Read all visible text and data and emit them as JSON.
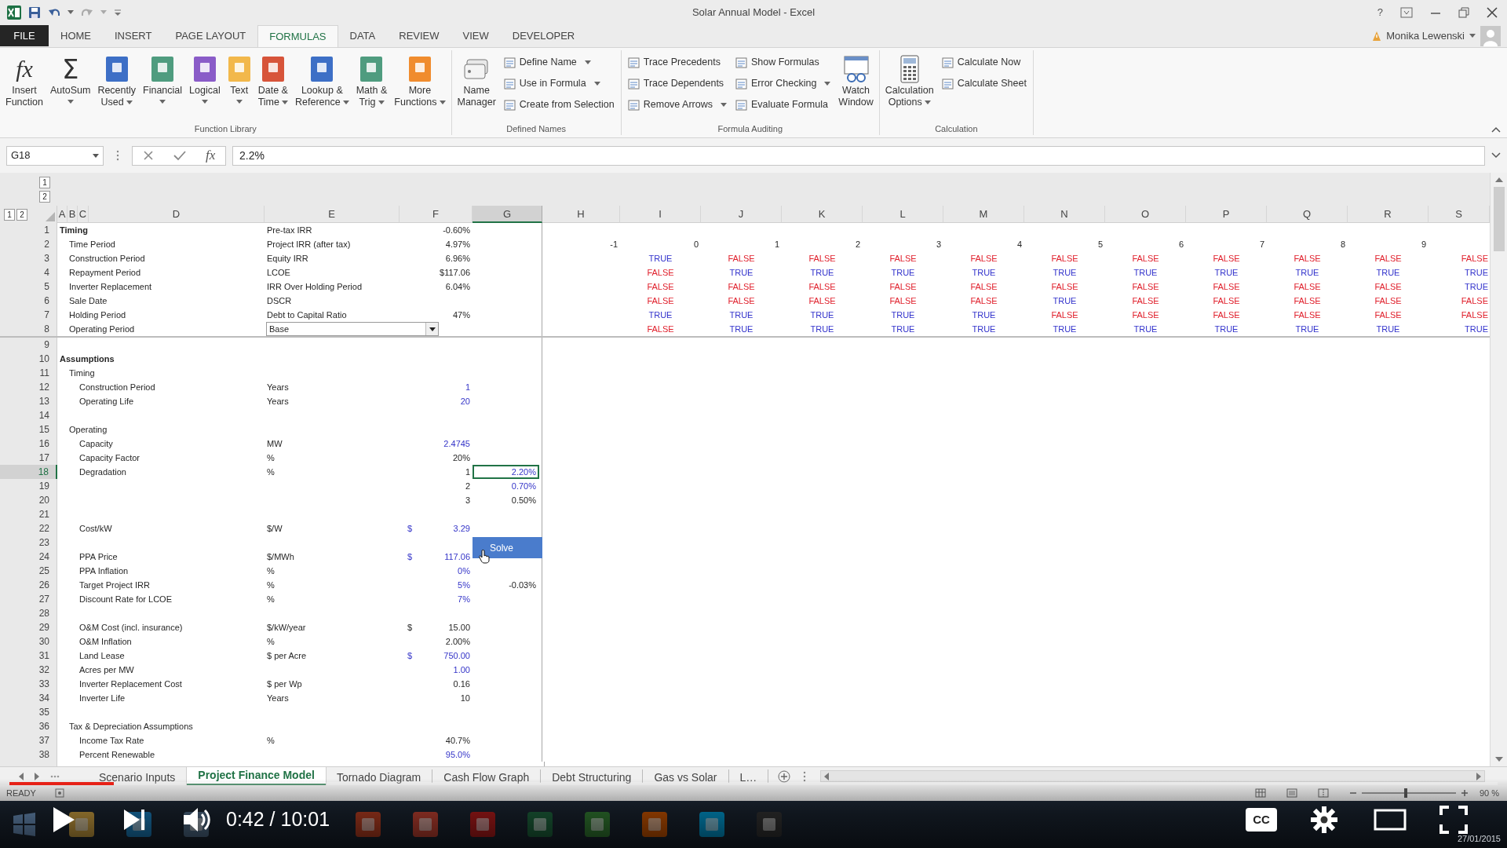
{
  "window": {
    "title": "Solar Annual Model - Excel",
    "help": "?",
    "user": "Monika Lewenski"
  },
  "tabs": [
    {
      "label": "FILE",
      "kind": "backstage",
      "selected": false
    },
    {
      "label": "HOME",
      "kind": "tab",
      "selected": false
    },
    {
      "label": "INSERT",
      "kind": "tab",
      "selected": false
    },
    {
      "label": "PAGE LAYOUT",
      "kind": "tab",
      "selected": false
    },
    {
      "label": "FORMULAS",
      "kind": "tab",
      "selected": true
    },
    {
      "label": "DATA",
      "kind": "tab",
      "selected": false
    },
    {
      "label": "REVIEW",
      "kind": "tab",
      "selected": false
    },
    {
      "label": "VIEW",
      "kind": "tab",
      "selected": false
    },
    {
      "label": "DEVELOPER",
      "kind": "tab",
      "selected": false
    }
  ],
  "ribbon": {
    "groups": [
      {
        "label": "Function Library",
        "items": [
          {
            "kind": "fx",
            "glyph": "fx",
            "label": "Insert\nFunction",
            "dropdown": false
          },
          {
            "kind": "sigma",
            "glyph": "Σ",
            "label": "AutoSum",
            "dropdown": true
          },
          {
            "kind": "book",
            "color": "#3d6fc6",
            "label": "Recently\nUsed",
            "dropdown": true
          },
          {
            "kind": "book",
            "color": "#4f9c7f",
            "label": "Financial",
            "dropdown": true
          },
          {
            "kind": "book",
            "color": "#8a5cc8",
            "label": "Logical",
            "dropdown": true
          },
          {
            "kind": "book",
            "color": "#f2b84b",
            "label": "Text",
            "dropdown": true
          },
          {
            "kind": "book",
            "color": "#d7543a",
            "label": "Date &\nTime",
            "dropdown": true
          },
          {
            "kind": "book",
            "color": "#3d6fc6",
            "label": "Lookup &\nReference",
            "dropdown": true
          },
          {
            "kind": "book",
            "color": "#4f9c7f",
            "label": "Math &\nTrig",
            "dropdown": true
          },
          {
            "kind": "book",
            "color": "#f08c2e",
            "label": "More\nFunctions",
            "dropdown": true
          }
        ]
      },
      {
        "label": "Defined Names",
        "items": [
          {
            "kind": "tags",
            "label": "Name\nManager",
            "dropdown": false
          },
          {
            "kind": "stack",
            "items": [
              {
                "label": "Define Name",
                "dropdown": true
              },
              {
                "label": "Use in Formula",
                "dropdown": true
              },
              {
                "label": "Create from Selection",
                "dropdown": false
              }
            ]
          }
        ]
      },
      {
        "label": "Formula Auditing",
        "items": [
          {
            "kind": "stack",
            "items": [
              {
                "label": "Trace Precedents",
                "dropdown": false
              },
              {
                "label": "Trace Dependents",
                "dropdown": false
              },
              {
                "label": "Remove Arrows",
                "dropdown": true
              }
            ]
          },
          {
            "kind": "stack",
            "items": [
              {
                "label": "Show Formulas",
                "dropdown": false
              },
              {
                "label": "Error Checking",
                "dropdown": true
              },
              {
                "label": "Evaluate Formula",
                "dropdown": false
              }
            ]
          },
          {
            "kind": "watch",
            "label": "Watch\nWindow",
            "dropdown": false
          }
        ]
      },
      {
        "label": "Calculation",
        "items": [
          {
            "kind": "calculator",
            "label": "Calculation\nOptions",
            "dropdown": true
          },
          {
            "kind": "stack",
            "items": [
              {
                "label": "Calculate Now",
                "dropdown": false
              },
              {
                "label": "Calculate Sheet",
                "dropdown": false
              }
            ]
          }
        ]
      }
    ]
  },
  "formula_bar": {
    "name_box": "G18",
    "function_glyph": "fx",
    "value": "2.2%"
  },
  "outline": {
    "top_levels": [
      "1",
      "2"
    ],
    "side_levels": [
      "1",
      "2"
    ]
  },
  "columns": [
    {
      "letter": "A",
      "selected": false
    },
    {
      "letter": "B",
      "selected": false
    },
    {
      "letter": "C",
      "selected": false
    },
    {
      "letter": "D",
      "selected": false
    },
    {
      "letter": "E",
      "selected": false
    },
    {
      "letter": "F",
      "selected": false
    },
    {
      "letter": "G",
      "selected": true
    },
    {
      "letter": "H",
      "selected": false
    },
    {
      "letter": "I",
      "selected": false
    },
    {
      "letter": "J",
      "selected": false
    },
    {
      "letter": "K",
      "selected": false
    },
    {
      "letter": "L",
      "selected": false
    },
    {
      "letter": "M",
      "selected": false
    },
    {
      "letter": "N",
      "selected": false
    },
    {
      "letter": "O",
      "selected": false
    },
    {
      "letter": "P",
      "selected": false
    },
    {
      "letter": "Q",
      "selected": false
    },
    {
      "letter": "R",
      "selected": false
    },
    {
      "letter": "S",
      "selected": false
    }
  ],
  "top_pane_rows": [
    {
      "number": "1",
      "selected": false,
      "a": "Timing",
      "e": "Pre-tax IRR",
      "f": "-0.60%",
      "f_input": false
    },
    {
      "number": "2",
      "selected": false,
      "b": "Time Period",
      "e": "Project IRR (after tax)",
      "f": "4.97%",
      "f_input": false,
      "period_numbers": [
        "-1",
        "0",
        "1",
        "2",
        "3",
        "4",
        "5",
        "6",
        "7",
        "8",
        "9"
      ]
    },
    {
      "number": "3",
      "selected": false,
      "b": "Construction Period",
      "e": "Equity IRR",
      "f": "6.96%",
      "f_input": false,
      "flags": [
        {
          "text": "TRUE",
          "color": "#3333cc"
        },
        {
          "text": "FALSE",
          "color": "#e0202c"
        },
        {
          "text": "FALSE",
          "color": "#e0202c"
        },
        {
          "text": "FALSE",
          "color": "#e0202c"
        },
        {
          "text": "FALSE",
          "color": "#e0202c"
        },
        {
          "text": "FALSE",
          "color": "#e0202c"
        },
        {
          "text": "FALSE",
          "color": "#e0202c"
        },
        {
          "text": "FALSE",
          "color": "#e0202c"
        },
        {
          "text": "FALSE",
          "color": "#e0202c"
        },
        {
          "text": "FALSE",
          "color": "#e0202c"
        },
        {
          "text": "FALSE",
          "color": "#e0202c"
        }
      ]
    },
    {
      "number": "4",
      "selected": false,
      "b": "Repayment Period",
      "e": "LCOE",
      "f": "$117.06",
      "f_input": false,
      "flags": [
        {
          "text": "FALSE",
          "color": "#e0202c"
        },
        {
          "text": "TRUE",
          "color": "#3333cc"
        },
        {
          "text": "TRUE",
          "color": "#3333cc"
        },
        {
          "text": "TRUE",
          "color": "#3333cc"
        },
        {
          "text": "TRUE",
          "color": "#3333cc"
        },
        {
          "text": "TRUE",
          "color": "#3333cc"
        },
        {
          "text": "TRUE",
          "color": "#3333cc"
        },
        {
          "text": "TRUE",
          "color": "#3333cc"
        },
        {
          "text": "TRUE",
          "color": "#3333cc"
        },
        {
          "text": "TRUE",
          "color": "#3333cc"
        },
        {
          "text": "TRUE",
          "color": "#3333cc"
        }
      ]
    },
    {
      "number": "5",
      "selected": false,
      "b": "Inverter Replacement",
      "e": "IRR Over Holding Period",
      "f": "6.04%",
      "f_input": false,
      "flags": [
        {
          "text": "FALSE",
          "color": "#e0202c"
        },
        {
          "text": "FALSE",
          "color": "#e0202c"
        },
        {
          "text": "FALSE",
          "color": "#e0202c"
        },
        {
          "text": "FALSE",
          "color": "#e0202c"
        },
        {
          "text": "FALSE",
          "color": "#e0202c"
        },
        {
          "text": "FALSE",
          "color": "#e0202c"
        },
        {
          "text": "FALSE",
          "color": "#e0202c"
        },
        {
          "text": "FALSE",
          "color": "#e0202c"
        },
        {
          "text": "FALSE",
          "color": "#e0202c"
        },
        {
          "text": "FALSE",
          "color": "#e0202c"
        },
        {
          "text": "TRUE",
          "color": "#3333cc"
        }
      ]
    },
    {
      "number": "6",
      "selected": false,
      "b": "Sale Date",
      "e": "DSCR",
      "flags": [
        {
          "text": "FALSE",
          "color": "#e0202c"
        },
        {
          "text": "FALSE",
          "color": "#e0202c"
        },
        {
          "text": "FALSE",
          "color": "#e0202c"
        },
        {
          "text": "FALSE",
          "color": "#e0202c"
        },
        {
          "text": "FALSE",
          "color": "#e0202c"
        },
        {
          "text": "TRUE",
          "color": "#3333cc"
        },
        {
          "text": "FALSE",
          "color": "#e0202c"
        },
        {
          "text": "FALSE",
          "color": "#e0202c"
        },
        {
          "text": "FALSE",
          "color": "#e0202c"
        },
        {
          "text": "FALSE",
          "color": "#e0202c"
        },
        {
          "text": "FALSE",
          "color": "#e0202c"
        }
      ]
    },
    {
      "number": "7",
      "selected": false,
      "b": "Holding Period",
      "e": "Debt to Capital Ratio",
      "f": "47%",
      "f_input": false,
      "flags": [
        {
          "text": "TRUE",
          "color": "#3333cc"
        },
        {
          "text": "TRUE",
          "color": "#3333cc"
        },
        {
          "text": "TRUE",
          "color": "#3333cc"
        },
        {
          "text": "TRUE",
          "color": "#3333cc"
        },
        {
          "text": "TRUE",
          "color": "#3333cc"
        },
        {
          "text": "FALSE",
          "color": "#e0202c"
        },
        {
          "text": "FALSE",
          "color": "#e0202c"
        },
        {
          "text": "FALSE",
          "color": "#e0202c"
        },
        {
          "text": "FALSE",
          "color": "#e0202c"
        },
        {
          "text": "FALSE",
          "color": "#e0202c"
        },
        {
          "text": "FALSE",
          "color": "#e0202c"
        }
      ]
    },
    {
      "number": "8",
      "selected": false,
      "b": "Operating Period",
      "dropdown": "Base",
      "flags": [
        {
          "text": "FALSE",
          "color": "#e0202c"
        },
        {
          "text": "TRUE",
          "color": "#3333cc"
        },
        {
          "text": "TRUE",
          "color": "#3333cc"
        },
        {
          "text": "TRUE",
          "color": "#3333cc"
        },
        {
          "text": "TRUE",
          "color": "#3333cc"
        },
        {
          "text": "TRUE",
          "color": "#3333cc"
        },
        {
          "text": "TRUE",
          "color": "#3333cc"
        },
        {
          "text": "TRUE",
          "color": "#3333cc"
        },
        {
          "text": "TRUE",
          "color": "#3333cc"
        },
        {
          "text": "TRUE",
          "color": "#3333cc"
        },
        {
          "text": "TRUE",
          "color": "#3333cc"
        }
      ]
    }
  ],
  "rows": [
    {
      "number": "9",
      "selected": false
    },
    {
      "number": "10",
      "selected": false,
      "a": "Assumptions"
    },
    {
      "number": "11",
      "selected": false,
      "b": "Timing"
    },
    {
      "number": "12",
      "selected": false,
      "c": "Construction Period",
      "e": "Years",
      "f": "1",
      "f_input": true
    },
    {
      "number": "13",
      "selected": false,
      "c": "Operating Life",
      "e": "Years",
      "f": "20",
      "f_input": true
    },
    {
      "number": "14",
      "selected": false
    },
    {
      "number": "15",
      "selected": false,
      "b": "Operating"
    },
    {
      "number": "16",
      "selected": false,
      "c": "Capacity",
      "e": "MW",
      "f": "2.4745",
      "f_input": true
    },
    {
      "number": "17",
      "selected": false,
      "c": "Capacity Factor",
      "e": "%",
      "f": "20%",
      "f_input": false
    },
    {
      "number": "18",
      "selected": true,
      "c": "Degradation",
      "e": "%",
      "f": "1",
      "f_input": false,
      "g": "2.20%",
      "g_input": true
    },
    {
      "number": "19",
      "selected": false,
      "f": "2",
      "f_input": false,
      "g": "0.70%",
      "g_input": true
    },
    {
      "number": "20",
      "selected": false,
      "f": "3",
      "f_input": false,
      "g": "0.50%",
      "g_input": false
    },
    {
      "number": "21",
      "selected": false
    },
    {
      "number": "22",
      "selected": false,
      "c": "Cost/kW",
      "e": "$/W",
      "f_currency": "$",
      "f": "3.29",
      "f_input": true
    },
    {
      "number": "23",
      "selected": false,
      "button": "Solve"
    },
    {
      "number": "24",
      "selected": false,
      "c": "PPA Price",
      "e": "$/MWh",
      "f_currency": "$",
      "f": "117.06",
      "f_input": true
    },
    {
      "number": "25",
      "selected": false,
      "c": "PPA Inflation",
      "e": "%",
      "f": "0%",
      "f_input": true
    },
    {
      "number": "26",
      "selected": false,
      "c": "Target Project IRR",
      "e": "%",
      "f": "5%",
      "f_input": true,
      "g": "-0.03%",
      "g_input": false
    },
    {
      "number": "27",
      "selected": false,
      "c": "Discount Rate for LCOE",
      "e": "%",
      "f": "7%",
      "f_input": true
    },
    {
      "number": "28",
      "selected": false
    },
    {
      "number": "29",
      "selected": false,
      "c": "O&M Cost (incl. insurance)",
      "e": "$/kW/year",
      "f_currency": "$",
      "f": "15.00",
      "f_input": false
    },
    {
      "number": "30",
      "selected": false,
      "c": "O&M Inflation",
      "e": "%",
      "f": "2.00%",
      "f_input": false
    },
    {
      "number": "31",
      "selected": false,
      "c": "Land Lease",
      "e": "$ per Acre",
      "f_currency": "$",
      "f": "750.00",
      "f_input": true
    },
    {
      "number": "32",
      "selected": false,
      "c": "Acres per MW",
      "f": "1.00",
      "f_input": true
    },
    {
      "number": "33",
      "selected": false,
      "c": "Inverter Replacement Cost",
      "e": "$ per Wp",
      "f": "0.16",
      "f_input": false
    },
    {
      "number": "34",
      "selected": false,
      "c": "Inverter Life",
      "e": "Years",
      "f": "10",
      "f_input": false
    },
    {
      "number": "35",
      "selected": false
    },
    {
      "number": "36",
      "selected": false,
      "b": "Tax & Depreciation Assumptions"
    },
    {
      "number": "37",
      "selected": false,
      "c": "Income Tax Rate",
      "e": "%",
      "f": "40.7%",
      "f_input": false
    },
    {
      "number": "38",
      "selected": false,
      "c": "Percent Renewable",
      "f": "95.0%",
      "f_input": true
    }
  ],
  "sheet_tabs": [
    {
      "label": "Scenario Inputs",
      "selected": false
    },
    {
      "label": "Project Finance Model",
      "selected": true
    },
    {
      "label": "Tornado Diagram",
      "selected": false
    },
    {
      "label": "Cash Flow Graph",
      "selected": false
    },
    {
      "label": "Debt Structuring",
      "selected": false
    },
    {
      "label": "Gas vs Solar",
      "selected": false
    },
    {
      "label": "L…",
      "selected": false
    }
  ],
  "status_bar": {
    "mode": "READY",
    "zoom": {
      "reading": "90 %",
      "level": 0.45
    }
  },
  "taskbar": {
    "date": "27/01/2015"
  },
  "player": {
    "time": "0:42 / 10:01",
    "captions": "CC",
    "progress": {
      "level": 0.07
    }
  }
}
